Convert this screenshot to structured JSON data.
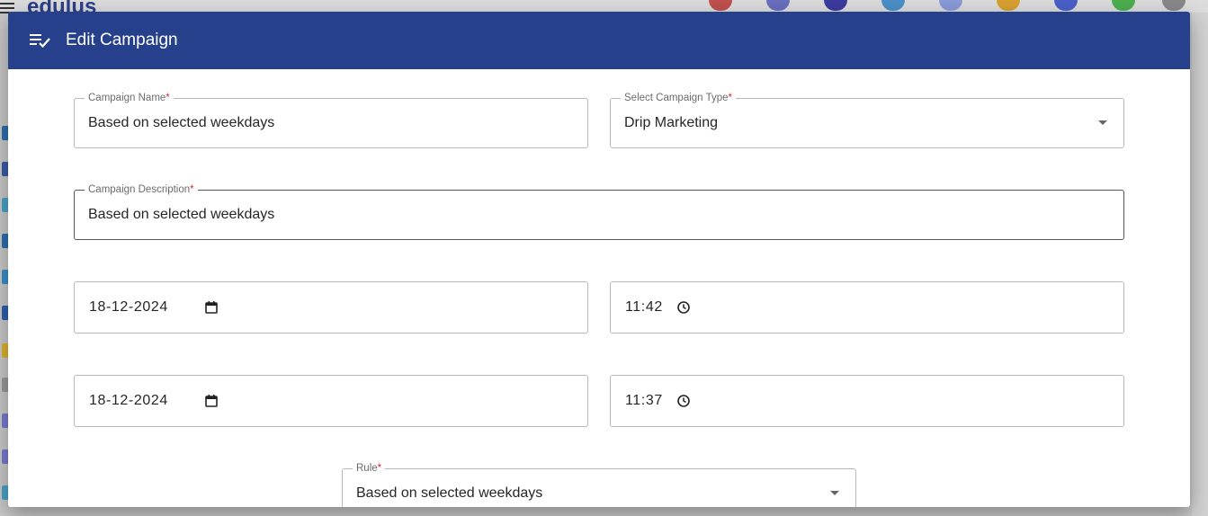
{
  "background": {
    "logo_text": "edulus"
  },
  "dialog": {
    "title": "Edit Campaign",
    "title_icon": "playlist-check-icon",
    "colors": {
      "header": "#26408b",
      "required": "#d32f2f"
    }
  },
  "form": {
    "campaign_name": {
      "label": "Campaign Name",
      "required_mark": "*",
      "value": "Based on selected weekdays"
    },
    "campaign_type": {
      "label": "Select Campaign Type",
      "required_mark": "*",
      "value": "Drip Marketing"
    },
    "campaign_description": {
      "label": "Campaign Description",
      "required_mark": "*",
      "value": "Based on selected weekdays"
    },
    "start_date": {
      "value": "18-12-2024",
      "icon": "calendar-icon"
    },
    "start_time": {
      "value": "11:42",
      "icon": "clock-icon"
    },
    "end_date": {
      "value": "18-12-2024",
      "icon": "calendar-icon"
    },
    "end_time": {
      "value": "11:37",
      "icon": "clock-icon"
    },
    "rule": {
      "label": "Rule",
      "required_mark": "*",
      "value": "Based on selected weekdays"
    }
  }
}
